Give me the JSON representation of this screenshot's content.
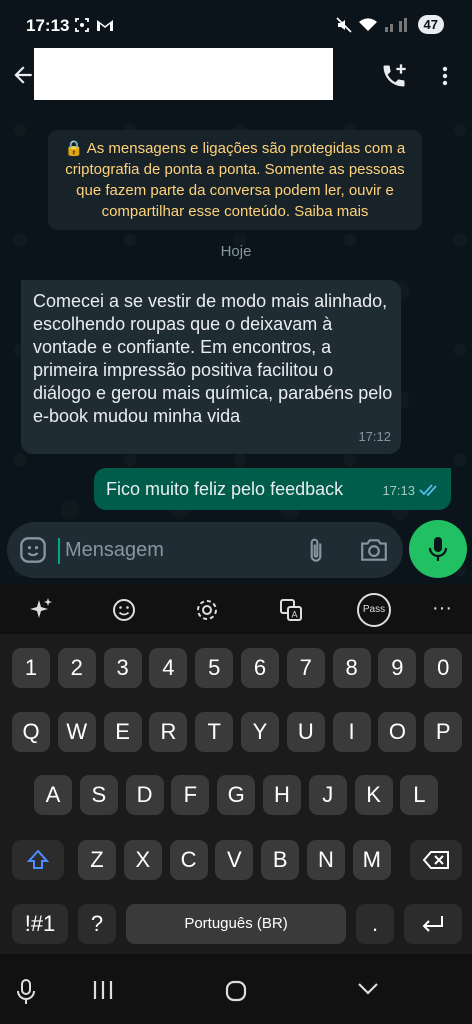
{
  "status_bar": {
    "time": "17:13",
    "battery": "47"
  },
  "header": {
    "contact_name": ""
  },
  "chat": {
    "encryption_notice": "🔒 As mensagens e ligações são protegidas com a criptografia de ponta a ponta. Somente as pessoas que fazem parte da conversa podem ler, ouvir e compartilhar esse conteúdo. Saiba mais",
    "date_label": "Hoje",
    "messages": [
      {
        "direction": "in",
        "text": "Comecei a se vestir de modo mais alinhado, escolhendo roupas que o deixavam à vontade e confiante. Em encontros, a primeira impressão positiva facilitou o diálogo e gerou mais química, parabéns pelo e-book mudou minha vida",
        "time": "17:12"
      },
      {
        "direction": "out",
        "text": "Fico muito feliz pelo feedback",
        "time": "17:13",
        "status": "read"
      }
    ]
  },
  "composer": {
    "placeholder": "Mensagem"
  },
  "keyboard": {
    "row_numbers": [
      "1",
      "2",
      "3",
      "4",
      "5",
      "6",
      "7",
      "8",
      "9",
      "0"
    ],
    "row_q": [
      "Q",
      "W",
      "E",
      "R",
      "T",
      "Y",
      "U",
      "I",
      "O",
      "P"
    ],
    "row_a": [
      "A",
      "S",
      "D",
      "F",
      "G",
      "H",
      "J",
      "K",
      "L"
    ],
    "row_z": [
      "Z",
      "X",
      "C",
      "V",
      "B",
      "N",
      "M"
    ],
    "symbols_label": "!#1",
    "question_label": "?",
    "space_label": "Português (BR)",
    "period_label": ".",
    "pass_label": "Pass",
    "more_label": "···"
  },
  "colors": {
    "accent": "#00a884",
    "outgoing_bubble": "#005c4b",
    "incoming_bubble": "#202c33",
    "mic": "#21c063"
  }
}
